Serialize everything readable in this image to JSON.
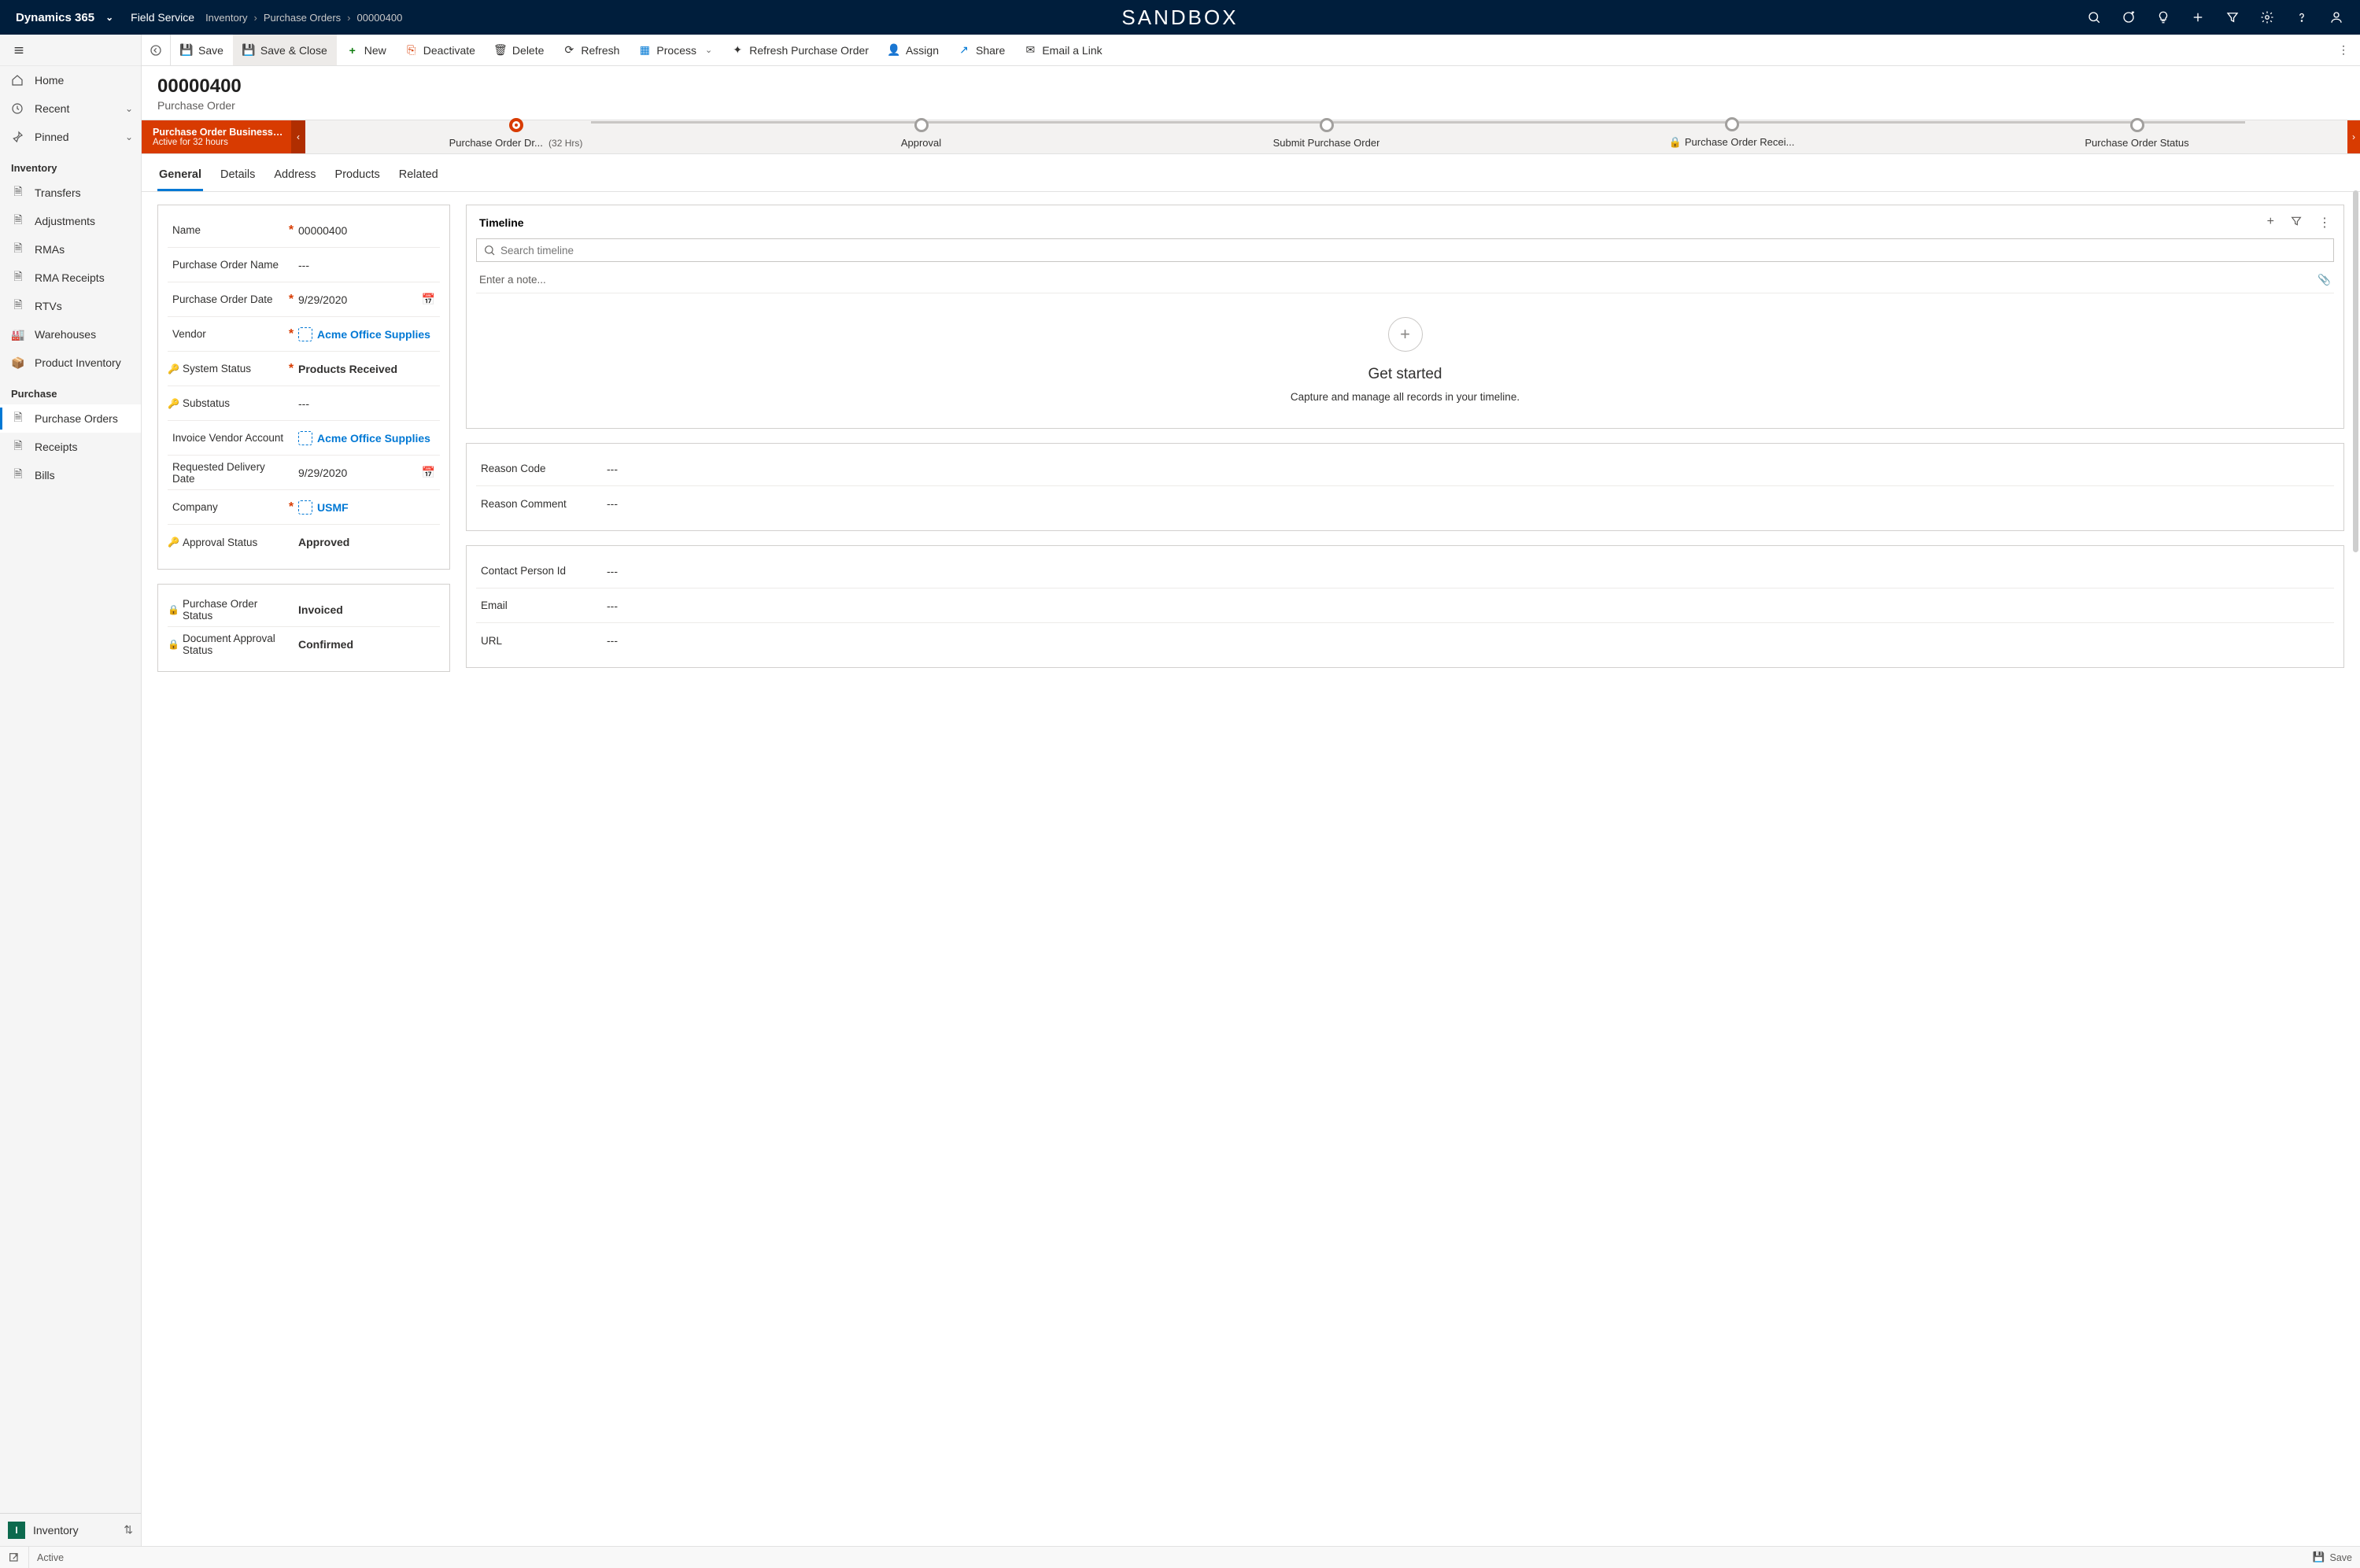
{
  "header": {
    "brand": "Dynamics 365",
    "app": "Field Service",
    "breadcrumb": [
      "Inventory",
      "Purchase Orders",
      "00000400"
    ],
    "sandbox": "SANDBOX"
  },
  "leftnav": {
    "home": "Home",
    "recent": "Recent",
    "pinned": "Pinned",
    "groups": [
      {
        "title": "Inventory",
        "items": [
          "Transfers",
          "Adjustments",
          "RMAs",
          "RMA Receipts",
          "RTVs",
          "Warehouses",
          "Product Inventory"
        ]
      },
      {
        "title": "Purchase",
        "items": [
          "Purchase Orders",
          "Receipts",
          "Bills"
        ]
      }
    ],
    "switcher": {
      "letter": "I",
      "label": "Inventory"
    }
  },
  "cmdbar": {
    "save": "Save",
    "saveclose": "Save & Close",
    "new": "New",
    "deactivate": "Deactivate",
    "delete": "Delete",
    "refresh": "Refresh",
    "process": "Process",
    "refresh_po": "Refresh Purchase Order",
    "assign": "Assign",
    "share": "Share",
    "email": "Email a Link"
  },
  "record": {
    "title": "00000400",
    "subtitle": "Purchase Order"
  },
  "bpf": {
    "name": "Purchase Order Business ...",
    "duration": "Active for 32 hours",
    "stages": [
      {
        "label": "Purchase Order Dr...",
        "sub": "(32 Hrs)",
        "current": true
      },
      {
        "label": "Approval"
      },
      {
        "label": "Submit Purchase Order"
      },
      {
        "label": "Purchase Order Recei...",
        "locked": true
      },
      {
        "label": "Purchase Order Status"
      }
    ]
  },
  "tabs": [
    "General",
    "Details",
    "Address",
    "Products",
    "Related"
  ],
  "form": {
    "card1": [
      {
        "label": "Name",
        "req": true,
        "value": "00000400"
      },
      {
        "label": "Purchase Order Name",
        "value": "---"
      },
      {
        "label": "Purchase Order Date",
        "req": true,
        "value": "9/29/2020",
        "date": true
      },
      {
        "label": "Vendor",
        "req": true,
        "value": "Acme Office Supplies",
        "link": true
      },
      {
        "label": "System Status",
        "req": true,
        "value": "Products Received",
        "key": true,
        "semi": true
      },
      {
        "label": "Substatus",
        "value": "---",
        "key": true
      },
      {
        "label": "Invoice Vendor Account",
        "value": "Acme Office Supplies",
        "link": true
      },
      {
        "label": "Requested Delivery Date",
        "value": "9/29/2020",
        "date": true
      },
      {
        "label": "Company",
        "req": true,
        "value": "USMF",
        "link": true
      },
      {
        "label": "Approval Status",
        "value": "Approved",
        "key": true,
        "semi": true
      }
    ],
    "card2": [
      {
        "label": "Purchase Order Status",
        "value": "Invoiced",
        "lock": true,
        "semi": true
      },
      {
        "label": "Document Approval Status",
        "value": "Confirmed",
        "lock": true,
        "semi": true
      }
    ],
    "reason": [
      {
        "label": "Reason Code",
        "value": "---"
      },
      {
        "label": "Reason Comment",
        "value": "---"
      }
    ],
    "contact": [
      {
        "label": "Contact Person Id",
        "value": "---"
      },
      {
        "label": "Email",
        "value": "---"
      },
      {
        "label": "URL",
        "value": "---"
      }
    ]
  },
  "timeline": {
    "title": "Timeline",
    "search_placeholder": "Search timeline",
    "note_placeholder": "Enter a note...",
    "empty_title": "Get started",
    "empty_sub": "Capture and manage all records in your timeline."
  },
  "statusbar": {
    "active": "Active",
    "save": "Save"
  }
}
